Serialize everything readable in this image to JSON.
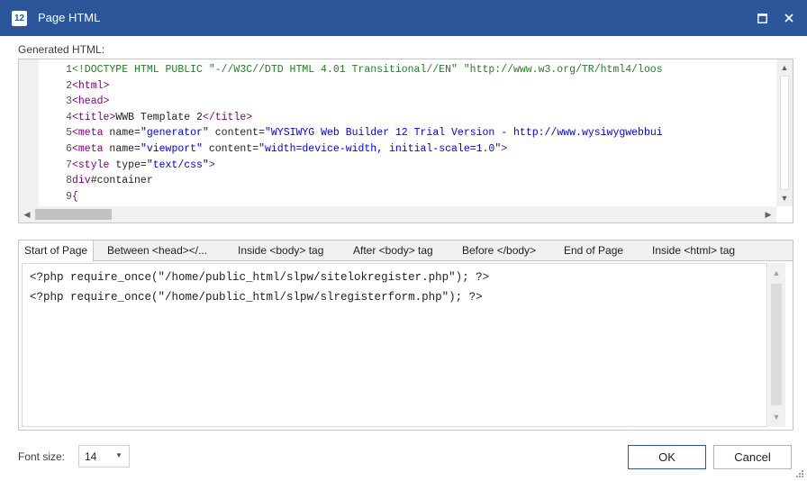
{
  "window": {
    "title": "Page HTML",
    "app_icon_label": "12",
    "titlebar_color": "#2b579a",
    "icons": [
      "maximize-icon",
      "close-icon"
    ]
  },
  "generated": {
    "label": "Generated HTML:"
  },
  "code": {
    "lines": [
      {
        "n": "1",
        "parts": [
          [
            "decl",
            "<!DOCTYPE HTML PUBLIC \"-//W3C//DTD HTML 4.01 Transitional//EN\" \"http://www.w3.org/TR/html4/loos"
          ]
        ]
      },
      {
        "n": "2",
        "parts": [
          [
            "tag",
            "<html>"
          ]
        ]
      },
      {
        "n": "3",
        "parts": [
          [
            "tag",
            "<head>"
          ]
        ]
      },
      {
        "n": "4",
        "parts": [
          [
            "tag",
            "<title>"
          ],
          [
            "text",
            "WWB Template 2"
          ],
          [
            "tag",
            "</title>"
          ]
        ]
      },
      {
        "n": "5",
        "parts": [
          [
            "tag",
            "<meta "
          ],
          [
            "attr",
            "name="
          ],
          [
            "str",
            "\"generator\""
          ],
          [
            "attr",
            " content="
          ],
          [
            "str",
            "\"WYSIWYG Web Builder 12 Trial Version - http://www.wysiwygwebbui"
          ]
        ]
      },
      {
        "n": "6",
        "parts": [
          [
            "tag",
            "<meta "
          ],
          [
            "attr",
            "name="
          ],
          [
            "str",
            "\"viewport\""
          ],
          [
            "attr",
            " content="
          ],
          [
            "str",
            "\"width=device-width, initial-scale=1.0\""
          ],
          [
            "tag",
            ">"
          ]
        ]
      },
      {
        "n": "7",
        "parts": [
          [
            "tag",
            "<style "
          ],
          [
            "attr",
            "type="
          ],
          [
            "str",
            "\"text/css\""
          ],
          [
            "tag",
            ">"
          ]
        ]
      },
      {
        "n": "8",
        "parts": [
          [
            "tag",
            "div"
          ],
          [
            "text",
            "#container"
          ]
        ]
      },
      {
        "n": "9",
        "parts": [
          [
            "tag",
            "{"
          ]
        ]
      }
    ]
  },
  "tabs": [
    {
      "label": "Start of Page",
      "active": true
    },
    {
      "label": "Between <head></...",
      "active": false
    },
    {
      "label": "Inside <body> tag",
      "active": false
    },
    {
      "label": "After <body> tag",
      "active": false
    },
    {
      "label": "Before </body>",
      "active": false
    },
    {
      "label": "End of Page",
      "active": false
    },
    {
      "label": "Inside <html> tag",
      "active": false
    }
  ],
  "snippet": {
    "lines": [
      "<?php require_once(\"/home/public_html/slpw/sitelokregister.php\"); ?>",
      "<?php require_once(\"/home/public_html/slpw/slregisterform.php\"); ?>"
    ]
  },
  "footer": {
    "font_size_label": "Font size:",
    "font_size_value": "14",
    "ok_label": "OK",
    "cancel_label": "Cancel"
  }
}
